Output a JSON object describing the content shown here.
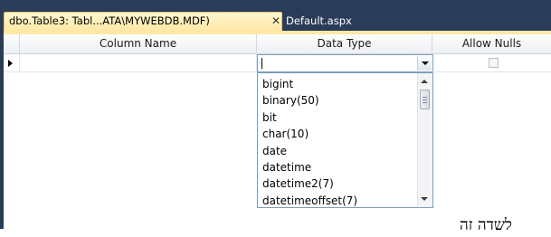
{
  "tabs": [
    {
      "label": "dbo.Table3: Tabl...ATA\\MYWEBDB.MDF)",
      "active": true,
      "close_glyph": "✕"
    },
    {
      "label": "Default.aspx",
      "active": false
    }
  ],
  "grid": {
    "columns": [
      "Column Name",
      "Data Type",
      "Allow Nulls"
    ],
    "row": {
      "column_name": "",
      "data_type": "",
      "allow_nulls": false
    }
  },
  "data_type_dropdown": {
    "options": [
      "bigint",
      "binary(50)",
      "bit",
      "char(10)",
      "date",
      "datetime",
      "datetime2(7)",
      "datetimeoffset(7)"
    ]
  },
  "overlay_text": "לשדה זה",
  "colors": {
    "frame": "#2b3c59",
    "active_tab": "#ffe8a6",
    "inactive_tab_text": "#ffffff"
  }
}
